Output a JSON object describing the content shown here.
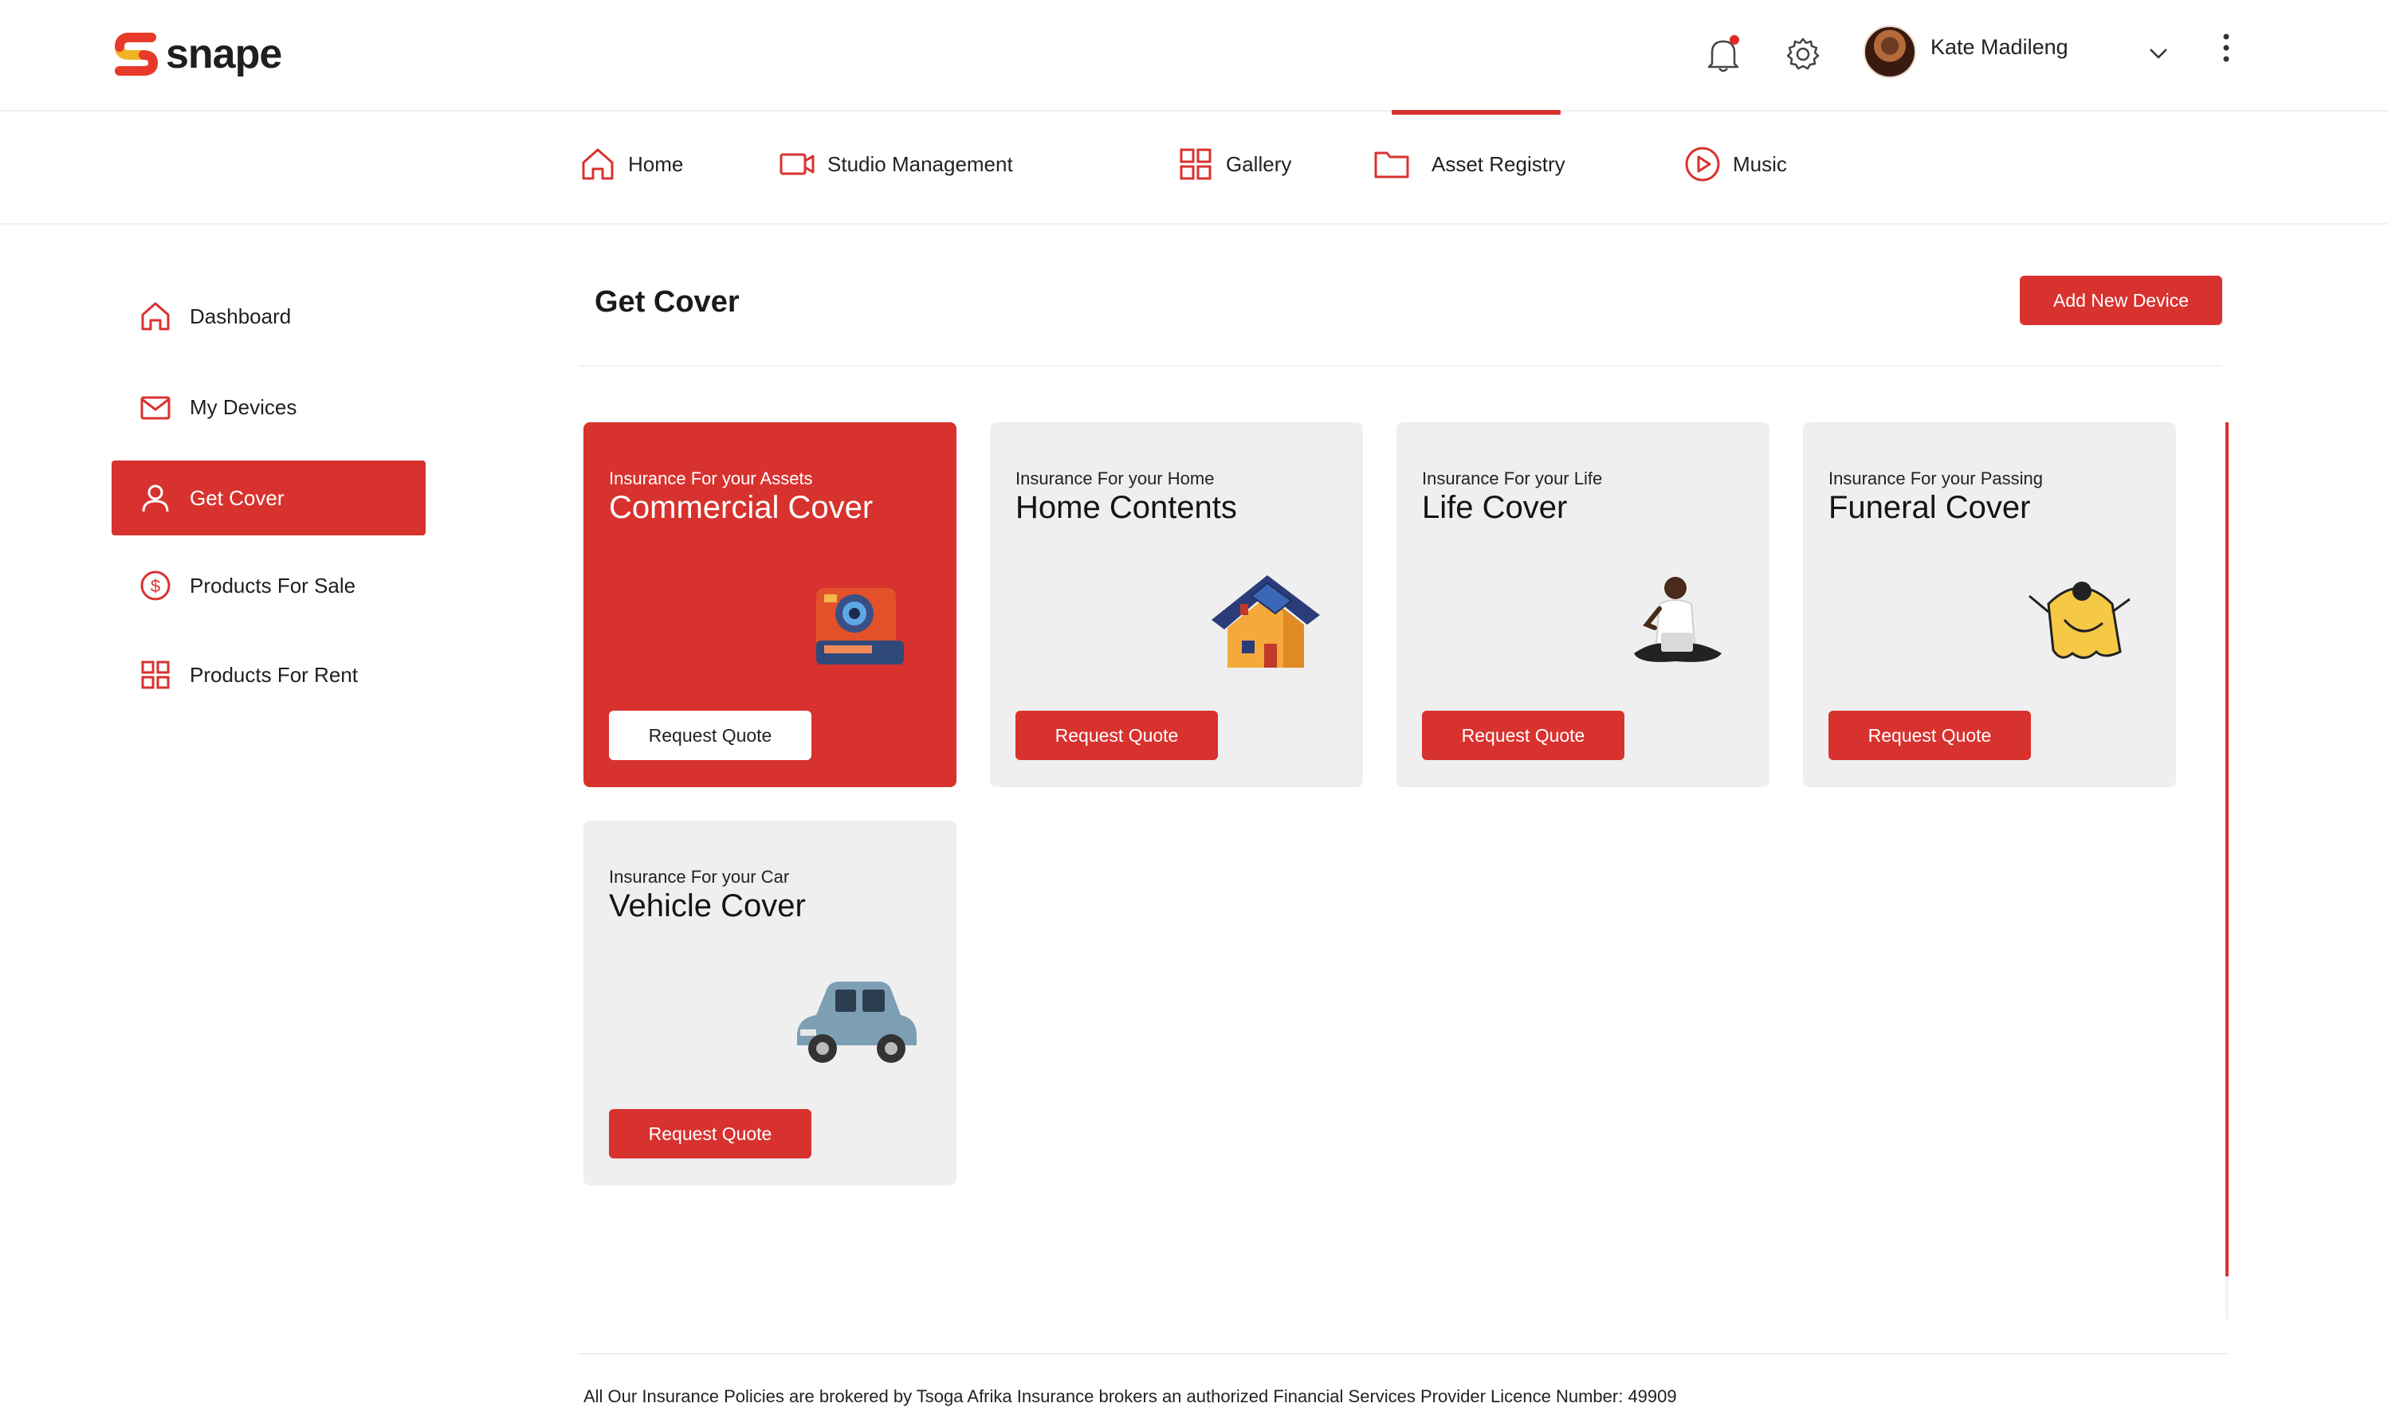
{
  "app": {
    "logo_text": "snape",
    "brand_color": "#d8322f"
  },
  "header": {
    "icons": [
      "bell-icon",
      "gear-icon"
    ],
    "user_name": "Kate Madileng"
  },
  "topnav": {
    "items": [
      {
        "label": "Home",
        "icon": "home-icon"
      },
      {
        "label": "Studio Management",
        "icon": "video-camera-icon"
      },
      {
        "label": "Gallery",
        "icon": "grid-icon"
      },
      {
        "label": "Asset Registry",
        "icon": "folder-icon",
        "active": true
      },
      {
        "label": "Music",
        "icon": "play-circle-icon"
      }
    ]
  },
  "sidebar": {
    "items": [
      {
        "label": "Dashboard",
        "icon": "home-icon"
      },
      {
        "label": "My Devices",
        "icon": "mail-icon"
      },
      {
        "label": "Get Cover",
        "icon": "user-icon",
        "active": true
      },
      {
        "label": "Products For Sale",
        "icon": "dollar-circle-icon"
      },
      {
        "label": "Products For Rent",
        "icon": "grid-icon"
      }
    ]
  },
  "main": {
    "title": "Get Cover",
    "add_button": "Add New Device",
    "cards": [
      {
        "eyebrow": "Insurance For your Assets",
        "title": "Commercial Cover",
        "button": "Request Quote",
        "illustration": "camera-illustration"
      },
      {
        "eyebrow": "Insurance For your Home",
        "title": "Home Contents",
        "button": "Request Quote",
        "illustration": "house-illustration"
      },
      {
        "eyebrow": "Insurance For your Life",
        "title": "Life Cover",
        "button": "Request Quote",
        "illustration": "person-laptop-illustration"
      },
      {
        "eyebrow": "Insurance For your Passing",
        "title": "Funeral Cover",
        "button": "Request Quote",
        "illustration": "ghost-illustration"
      },
      {
        "eyebrow": "Insurance For your Car",
        "title": "Vehicle Cover",
        "button": "Request Quote",
        "illustration": "car-illustration"
      }
    ]
  },
  "footer": {
    "text": "All Our Insurance Policies are brokered by Tsoga Afrika Insurance brokers an authorized Financial Services Provider Licence Number: 49909"
  }
}
